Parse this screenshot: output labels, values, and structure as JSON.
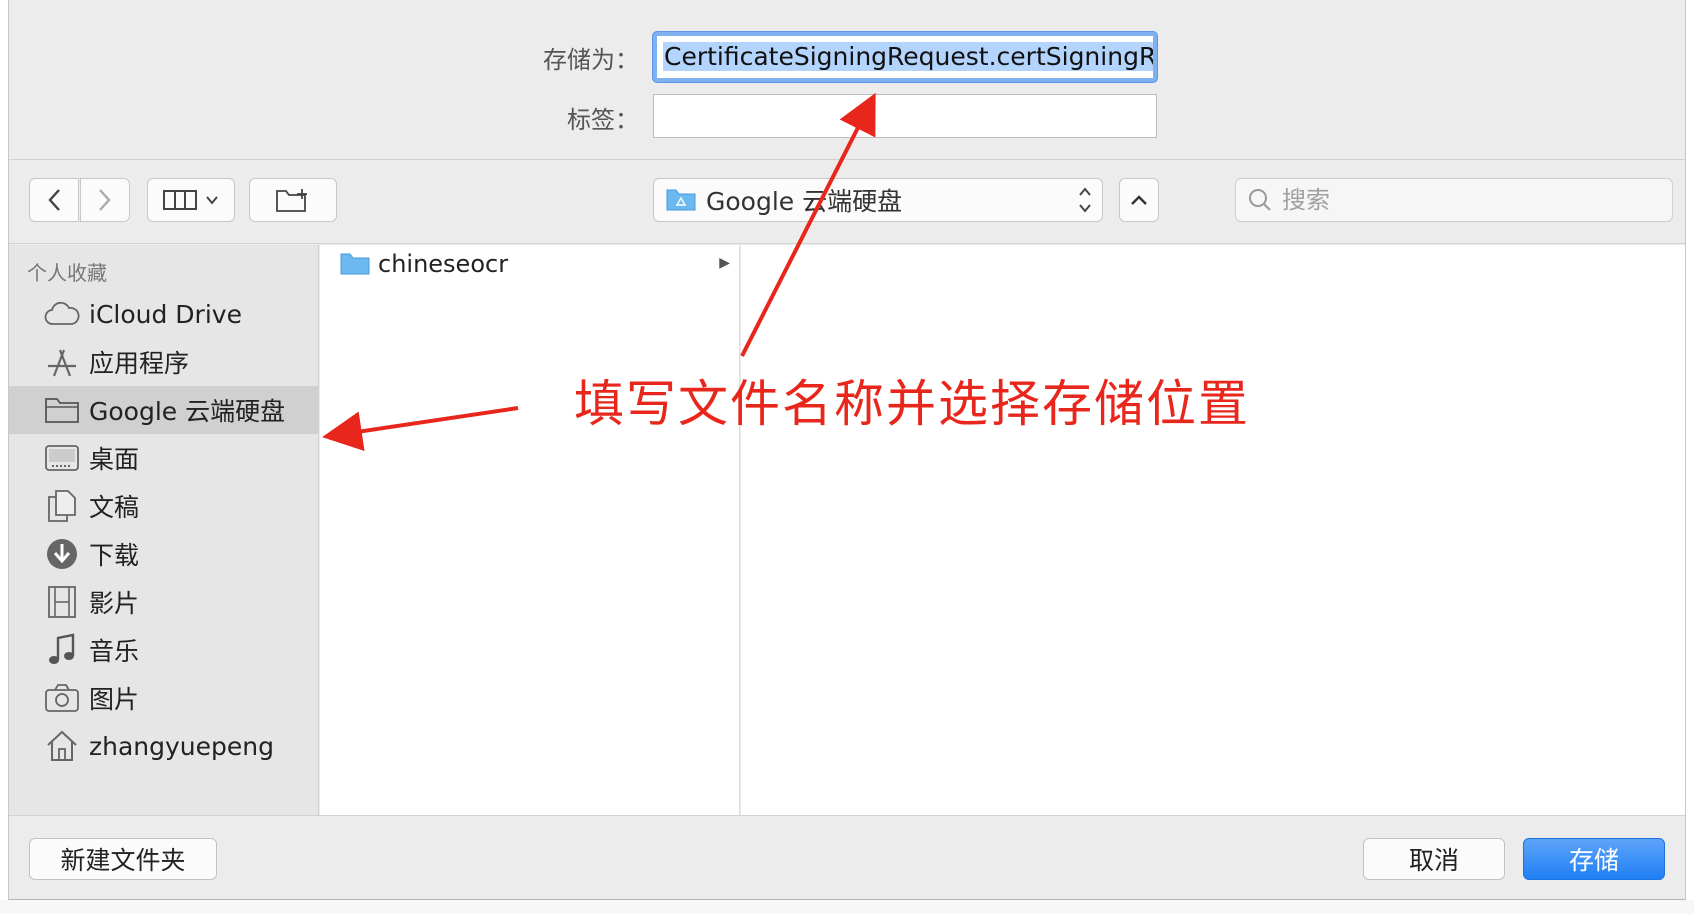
{
  "save_form": {
    "save_as_label": "存储为：",
    "filename_value": "CertificateSigningRequest.certSigningRe",
    "tags_label": "标签：",
    "tags_value": ""
  },
  "toolbar": {
    "location": "Google 云端硬盘",
    "search_placeholder": "搜索"
  },
  "sidebar": {
    "heading": "个人收藏",
    "items": [
      {
        "label": "iCloud Drive",
        "icon": "cloud-icon",
        "selected": false
      },
      {
        "label": "应用程序",
        "icon": "applications-icon",
        "selected": false
      },
      {
        "label": "Google 云端硬盘",
        "icon": "folder-icon",
        "selected": true
      },
      {
        "label": "桌面",
        "icon": "desktop-icon",
        "selected": false
      },
      {
        "label": "文稿",
        "icon": "documents-icon",
        "selected": false
      },
      {
        "label": "下载",
        "icon": "download-icon",
        "selected": false
      },
      {
        "label": "影片",
        "icon": "movies-icon",
        "selected": false
      },
      {
        "label": "音乐",
        "icon": "music-icon",
        "selected": false
      },
      {
        "label": "图片",
        "icon": "camera-icon",
        "selected": false
      },
      {
        "label": "zhangyuepeng",
        "icon": "home-icon",
        "selected": false
      }
    ]
  },
  "files": [
    {
      "name": "chineseocr",
      "type": "folder"
    }
  ],
  "buttons": {
    "new_folder": "新建文件夹",
    "cancel": "取消",
    "save": "存储"
  },
  "annotation": {
    "text": "填写文件名称并选择存储位置",
    "color": "#e8261c"
  },
  "colors": {
    "accent": "#1f7ff3",
    "selection": "#b3d4fc",
    "folder": "#6cb8f0"
  }
}
